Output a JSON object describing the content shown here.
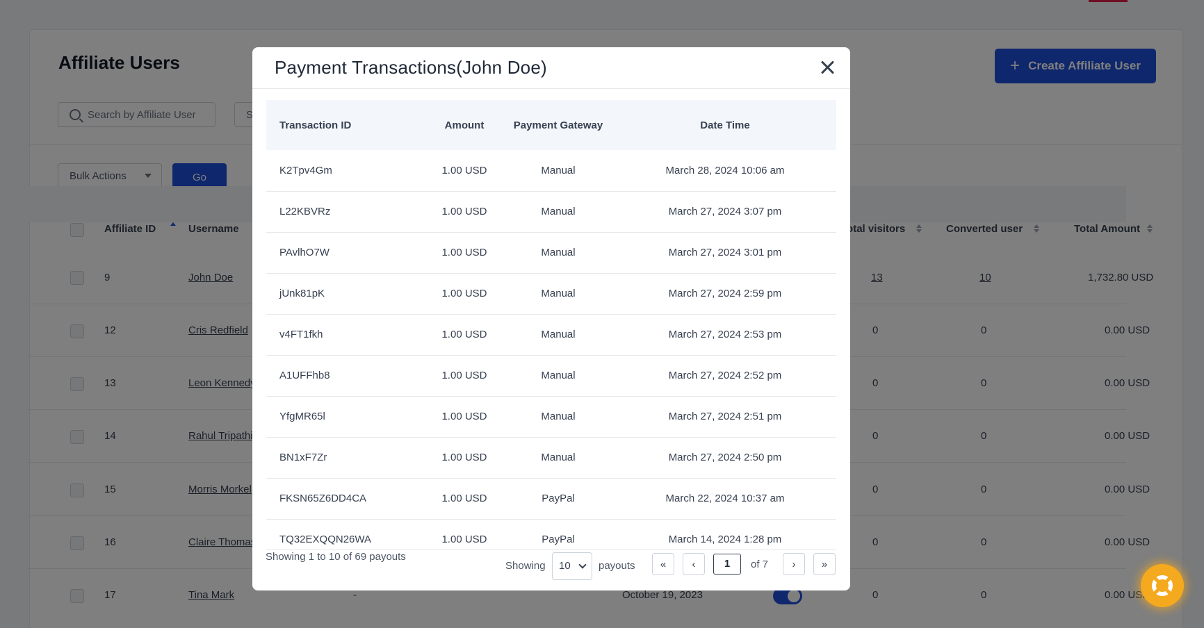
{
  "page": {
    "title": "Affiliate Users",
    "create_button": "Create Affiliate User",
    "search_placeholder": "Search by Affiliate User",
    "filter_partial": "S",
    "bulk_actions": "Bulk Actions",
    "go_button": "Go",
    "columns": {
      "affiliate_id": "Affiliate ID",
      "username": "Username",
      "total_visitors": "Total visitors",
      "converted_user": "Converted user",
      "total_amount": "Total Amount"
    },
    "rows": [
      {
        "id": "9",
        "username": "John Doe",
        "visitors": "13",
        "converted": "10",
        "amount": "1,732.80 USD"
      },
      {
        "id": "12",
        "username": "Cris Redfield",
        "visitors": "0",
        "converted": "0",
        "amount": "0.00 USD"
      },
      {
        "id": "13",
        "username": "Leon Kennedy",
        "visitors": "0",
        "converted": "0",
        "amount": "0.00 USD"
      },
      {
        "id": "14",
        "username": "Rahul Tripathi",
        "visitors": "0",
        "converted": "0",
        "amount": "0.00 USD"
      },
      {
        "id": "15",
        "username": "Morris Morkel",
        "visitors": "0",
        "converted": "0",
        "amount": "0.00 USD"
      },
      {
        "id": "16",
        "username": "Claire Thomas",
        "visitors": "0",
        "converted": "0",
        "amount": "0.00 USD"
      },
      {
        "id": "17",
        "username": "Tina Mark",
        "dash": "-",
        "date": "October 19, 2023",
        "visitors": "0",
        "converted": "0",
        "amount": "0.00 USD"
      }
    ]
  },
  "modal": {
    "title": "Payment Transactions(John Doe)",
    "columns": [
      "Transaction ID",
      "Amount",
      "Payment Gateway",
      "Date Time"
    ],
    "transactions": [
      [
        "K2Tpv4Gm",
        "1.00 USD",
        "Manual",
        "March 28, 2024 10:06 am"
      ],
      [
        "L22KBVRz",
        "1.00 USD",
        "Manual",
        "March 27, 2024 3:07 pm"
      ],
      [
        "PAvlhO7W",
        "1.00 USD",
        "Manual",
        "March 27, 2024 3:01 pm"
      ],
      [
        "jUnk81pK",
        "1.00 USD",
        "Manual",
        "March 27, 2024 2:59 pm"
      ],
      [
        "v4FT1fkh",
        "1.00 USD",
        "Manual",
        "March 27, 2024 2:53 pm"
      ],
      [
        "A1UFFhb8",
        "1.00 USD",
        "Manual",
        "March 27, 2024 2:52 pm"
      ],
      [
        "YfgMR65l",
        "1.00 USD",
        "Manual",
        "March 27, 2024 2:51 pm"
      ],
      [
        "BN1xF7Zr",
        "1.00 USD",
        "Manual",
        "March 27, 2024 2:50 pm"
      ],
      [
        "FKSN65Z6DD4CA",
        "1.00 USD",
        "PayPal",
        "March 22, 2024 10:37 am"
      ],
      [
        "TQ32EXQQN26WA",
        "1.00 USD",
        "PayPal",
        "March 14, 2024 1:28 pm"
      ]
    ],
    "footer": {
      "summary": "Showing 1 to 10 of 69 payouts",
      "showing_label": "Showing",
      "per_page": "10",
      "payouts_label": "payouts",
      "current_page": "1",
      "of_pages": "of 7",
      "first_glyph": "«",
      "prev_glyph": "‹",
      "next_glyph": "›",
      "last_glyph": "»"
    }
  },
  "colors": {
    "primary": "#1e4fd8",
    "help_widget": "#f5a91e",
    "overlay": "rgba(0,0,0,0.5)"
  },
  "icons": [
    "search-icon",
    "plus-icon",
    "caret-down-icon",
    "sort-icon",
    "close-icon",
    "chevron-down-icon",
    "help-widget-icon"
  ]
}
